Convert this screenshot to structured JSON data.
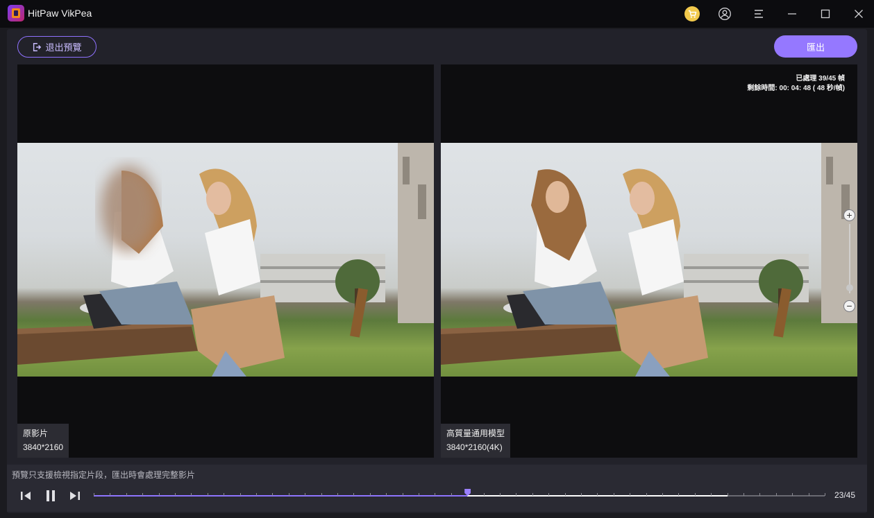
{
  "app": {
    "title": "HitPaw VikPea"
  },
  "toolbar": {
    "exit_preview_label": "退出預覽",
    "export_label": "匯出"
  },
  "left_pane": {
    "name": "原影片",
    "resolution": "3840*2160"
  },
  "right_pane": {
    "name": "高質量通用模型",
    "resolution": "3840*2160(4K)",
    "processed": "已處理 39/45 幀",
    "remaining": "剩餘時間: 00: 04: 48 ( 48 秒/幀)"
  },
  "zoom": {
    "plus": "+",
    "minus": "−"
  },
  "footer": {
    "hint": "預覽只支援檢視指定片段，匯出時會處理完整影片",
    "frame_counter": "23/45"
  },
  "timeline": {
    "current_frame": 23,
    "processed_frames": 39,
    "total_frames": 45
  },
  "colors": {
    "accent": "#9578ff",
    "titlebar": "#0c0c0f",
    "cart_badge": "#f2c94c"
  },
  "icons": [
    "app-logo-icon",
    "cart-icon",
    "user-icon",
    "menu-icon",
    "minimize-icon",
    "maximize-icon",
    "close-icon",
    "exit-icon",
    "prev-frame-icon",
    "pause-icon",
    "next-frame-icon",
    "zoom-in-icon",
    "zoom-out-icon"
  ]
}
